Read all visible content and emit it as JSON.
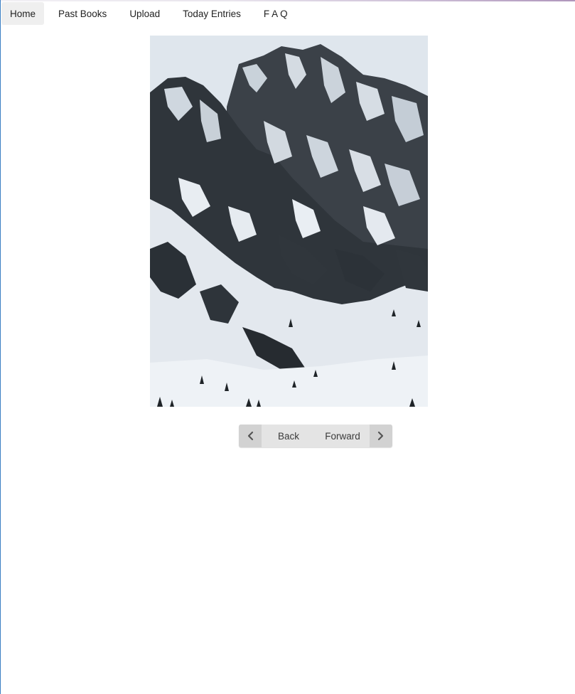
{
  "nav": {
    "items": [
      {
        "label": "Home",
        "active": true
      },
      {
        "label": "Past Books",
        "active": false
      },
      {
        "label": "Upload",
        "active": false
      },
      {
        "label": "Today Entries",
        "active": false
      },
      {
        "label": "F A Q",
        "active": false
      }
    ]
  },
  "image": {
    "subject": "snow-covered mountain with conifer trees"
  },
  "pager": {
    "back_label": "Back",
    "forward_label": "Forward",
    "back_icon": "chevron-left-icon",
    "forward_icon": "chevron-right-icon"
  },
  "colors": {
    "active_tab_bg": "#efefef",
    "pager_bg": "#e4e4e4",
    "pager_arrow_bg": "#d2d2d2",
    "left_border": "#3b7fc4"
  }
}
